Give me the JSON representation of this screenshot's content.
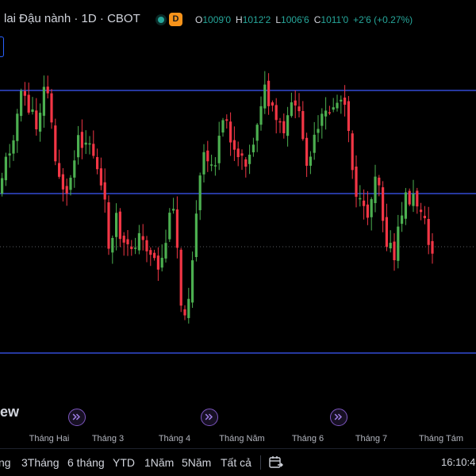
{
  "header": {
    "title": "lai Đậu nành · 1D · CBOT",
    "badge": "D",
    "ohlc": {
      "open_label": "O",
      "open": "1009'0",
      "high_label": "H",
      "high": "1012'2",
      "low_label": "L",
      "low": "1006'6",
      "close_label": "C",
      "close": "1011'0",
      "change": "+2'6 (+0.27%)"
    }
  },
  "colors": {
    "up": "#26a69a",
    "candle_up": "#4caf50",
    "candle_down": "#f23645",
    "level_line": "#3d5afe",
    "event": "#7e57c2",
    "background": "#000000"
  },
  "watermark": "ew",
  "time_axis": [
    "Tháng Hai",
    "Tháng 3",
    "Tháng 4",
    "Tháng Năm",
    "Tháng 6",
    "Tháng 7",
    "Tháng Tám"
  ],
  "event_markers": [
    {
      "icon": "forward-arrow-icon"
    },
    {
      "icon": "forward-arrow-icon"
    },
    {
      "icon": "forward-arrow-icon"
    }
  ],
  "toolbar": {
    "ranges": [
      "ng",
      "3Tháng",
      "6 tháng",
      "YTD",
      "1Năm",
      "5Năm",
      "Tất cả"
    ],
    "calendar_icon": "calendar-range-icon",
    "clock": "16:10:4"
  },
  "chart_data": {
    "type": "candlestick",
    "x": [
      "Tháng Hai",
      "Tháng 3",
      "Tháng 4",
      "Tháng Năm",
      "Tháng 6",
      "Tháng 7",
      "Tháng Tám"
    ],
    "last_close": 1011.0,
    "horizontal_levels": 3,
    "grid": false,
    "seed": 11
  }
}
